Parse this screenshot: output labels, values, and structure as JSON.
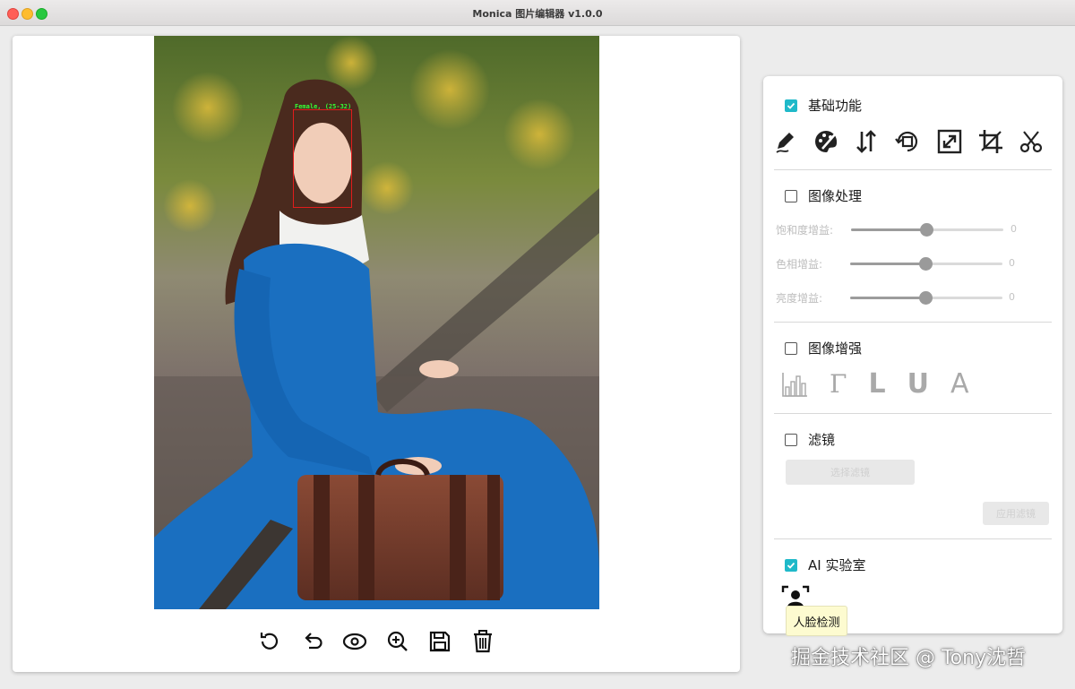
{
  "window": {
    "title": "Monica 图片编辑器 v1.0.0"
  },
  "canvas": {
    "face_detection_label": "Female, (25-32)"
  },
  "bottom_toolbar": {
    "icons": [
      "reset-icon",
      "undo-icon",
      "preview-eye-icon",
      "zoom-in-icon",
      "save-icon",
      "delete-icon"
    ]
  },
  "panel": {
    "basic": {
      "label": "基础功能",
      "checked": true,
      "icons": [
        "draw-pencil-icon",
        "palette-icon",
        "flip-arrows-icon",
        "rotate-icon",
        "resize-icon",
        "crop-icon",
        "scissors-icon"
      ]
    },
    "image_processing": {
      "label": "图像处理",
      "checked": false,
      "sliders": [
        {
          "label": "饱和度增益:",
          "value": "0",
          "level": 0.5
        },
        {
          "label": "色相增益:",
          "value": "0",
          "level": 0.5
        },
        {
          "label": "亮度增益:",
          "value": "0",
          "level": 0.5
        }
      ]
    },
    "image_enhance": {
      "label": "图像增强",
      "checked": false,
      "icons": [
        "histogram-icon"
      ],
      "letters": [
        "Γ",
        "L",
        "U",
        "A"
      ]
    },
    "filter": {
      "label": "滤镜",
      "checked": false,
      "select_button": "选择滤镜",
      "apply_button": "应用滤镜"
    },
    "ai_lab": {
      "label": "AI 实验室",
      "checked": true,
      "icons": [
        "face-detect-icon"
      ],
      "tooltip": "人脸检测"
    }
  },
  "watermark": "掘金技术社区 @ Tony沈哲",
  "colors": {
    "accent_checkbox": "#1fb9c9",
    "dress_blue": "#1a6fc0",
    "face_box": "#e11c1c",
    "face_label": "#35ff35"
  }
}
